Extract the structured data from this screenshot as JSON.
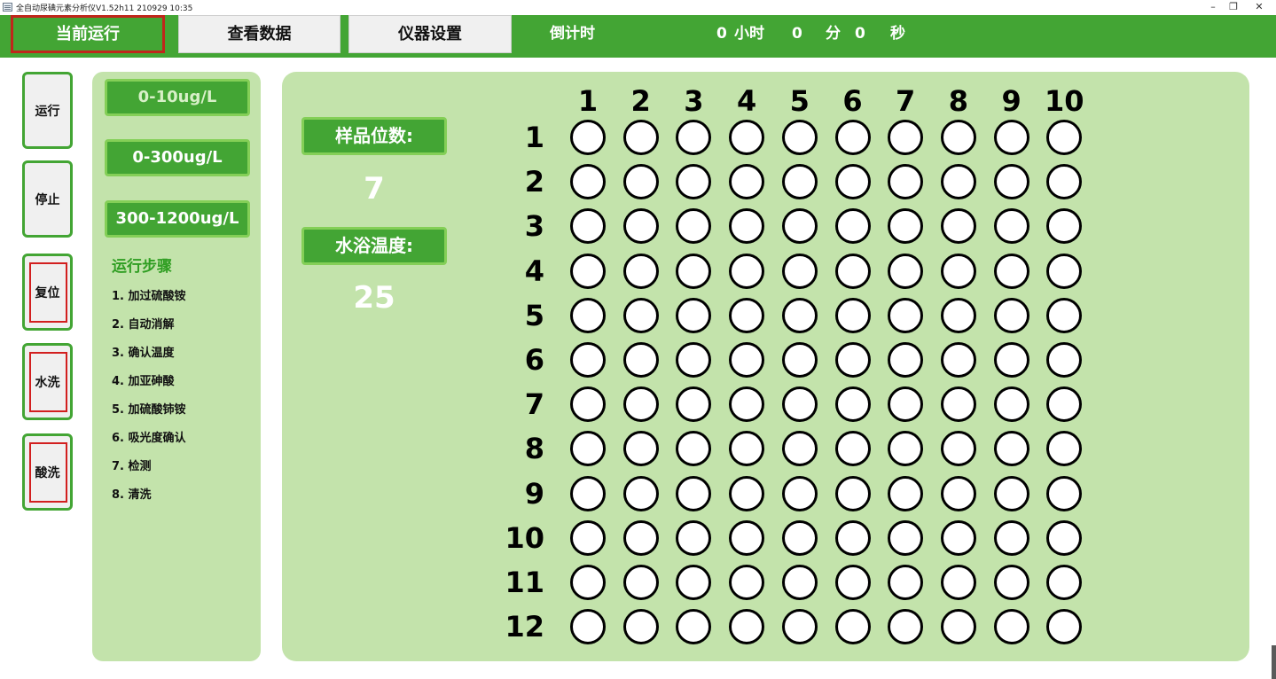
{
  "window": {
    "title": "全自动尿碘元素分析仪V1.52h11 210929 10:35",
    "minimize": "–",
    "restore": "❐",
    "close": "✕"
  },
  "nav": {
    "tabs": [
      "当前运行",
      "查看数据",
      "仪器设置"
    ],
    "countdown_label": "倒计时",
    "hours_value": "0",
    "hours_unit": "小时",
    "minutes_value": "0",
    "minutes_unit": "分",
    "seconds_value": "0",
    "seconds_unit": "秒"
  },
  "side_buttons": [
    "运行",
    "停止",
    "复位",
    "水洗",
    "酸洗"
  ],
  "ranges": [
    "0-10ug/L",
    "0-300ug/L",
    "300-1200ug/L"
  ],
  "steps_title": "运行步骤",
  "steps": [
    "1. 加过硫酸铵",
    "2. 自动消解",
    "3. 确认温度",
    "4. 加亚砷酸",
    "5. 加硫酸铈铵",
    "6. 吸光度确认",
    "7. 检测",
    "8. 清洗"
  ],
  "info": {
    "sample_label": "样品位数:",
    "sample_value": "7",
    "temp_label": "水浴温度:",
    "temp_value": "25"
  },
  "grid": {
    "columns": [
      "1",
      "2",
      "3",
      "4",
      "5",
      "6",
      "7",
      "8",
      "9",
      "10"
    ],
    "rows": [
      "1",
      "2",
      "3",
      "4",
      "5",
      "6",
      "7",
      "8",
      "9",
      "10",
      "11",
      "12"
    ]
  },
  "colors": {
    "brand_green": "#43a534",
    "panel_green": "#c3e3ab",
    "highlight_red": "#d21f1f"
  }
}
